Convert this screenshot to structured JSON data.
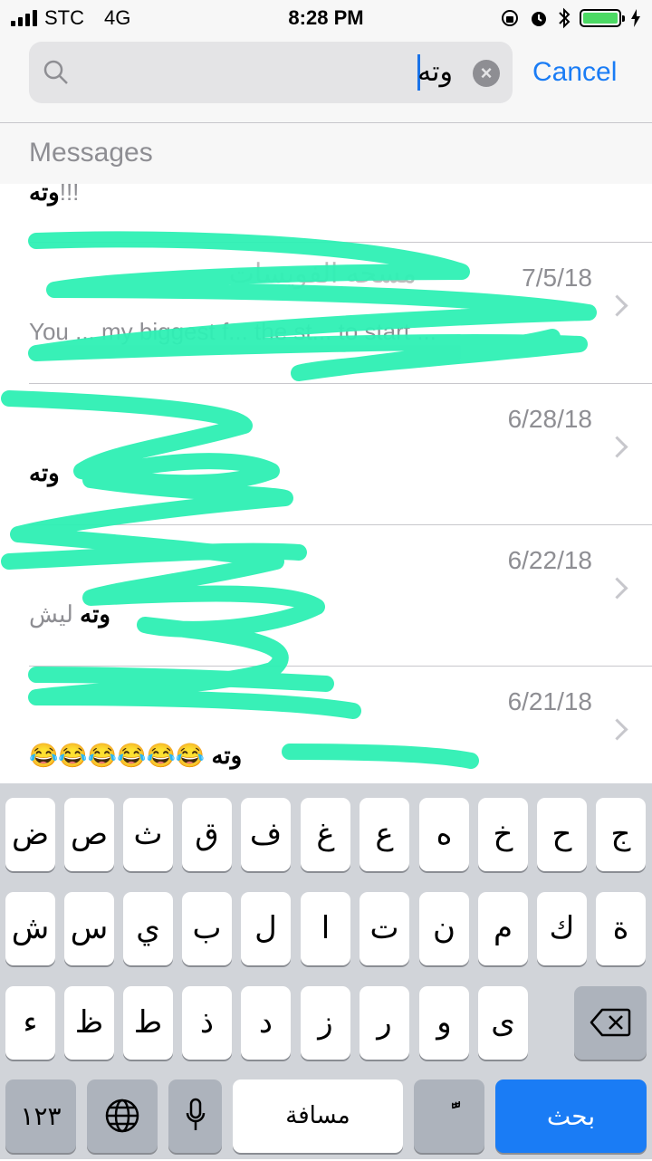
{
  "status_bar": {
    "carrier": "STC",
    "network": "4G",
    "time": "8:28 PM",
    "battery_color": "#4cd964"
  },
  "search": {
    "query": "وته",
    "cancel_label": "Cancel"
  },
  "section": {
    "title": "Messages"
  },
  "partial_row": {
    "bold": "وته",
    "rest": "!!!"
  },
  "rows": [
    {
      "name": "مسحه الفويسات",
      "date": "7/5/18",
      "preview": "You ... my biggest f... the st... to start ...",
      "preview_bold": ""
    },
    {
      "name": "",
      "date": "6/28/18",
      "preview": "",
      "preview_bold": "وته"
    },
    {
      "name": "",
      "date": "6/22/18",
      "preview": " ليش",
      "preview_bold": "وته"
    },
    {
      "name": "",
      "date": "6/21/18",
      "preview": "😂😂😂😂😂😂 ",
      "preview_bold": "وته"
    }
  ],
  "keyboard": {
    "row1": [
      "ض",
      "ص",
      "ث",
      "ق",
      "ف",
      "غ",
      "ع",
      "ه",
      "خ",
      "ح",
      "ج"
    ],
    "row2": [
      "ش",
      "س",
      "ي",
      "ب",
      "ل",
      "ا",
      "ت",
      "ن",
      "م",
      "ك",
      "ة"
    ],
    "row3": [
      "ء",
      "ظ",
      "ط",
      "ذ",
      "د",
      "ز",
      "ر",
      "و",
      "ى"
    ],
    "numbers_label": "١٢٣",
    "space_label": "مسافة",
    "diacritic_label": "ًّ",
    "search_label": "بحث"
  },
  "colors": {
    "accent": "#1a7cf5",
    "scribble": "#2ef0b4"
  }
}
